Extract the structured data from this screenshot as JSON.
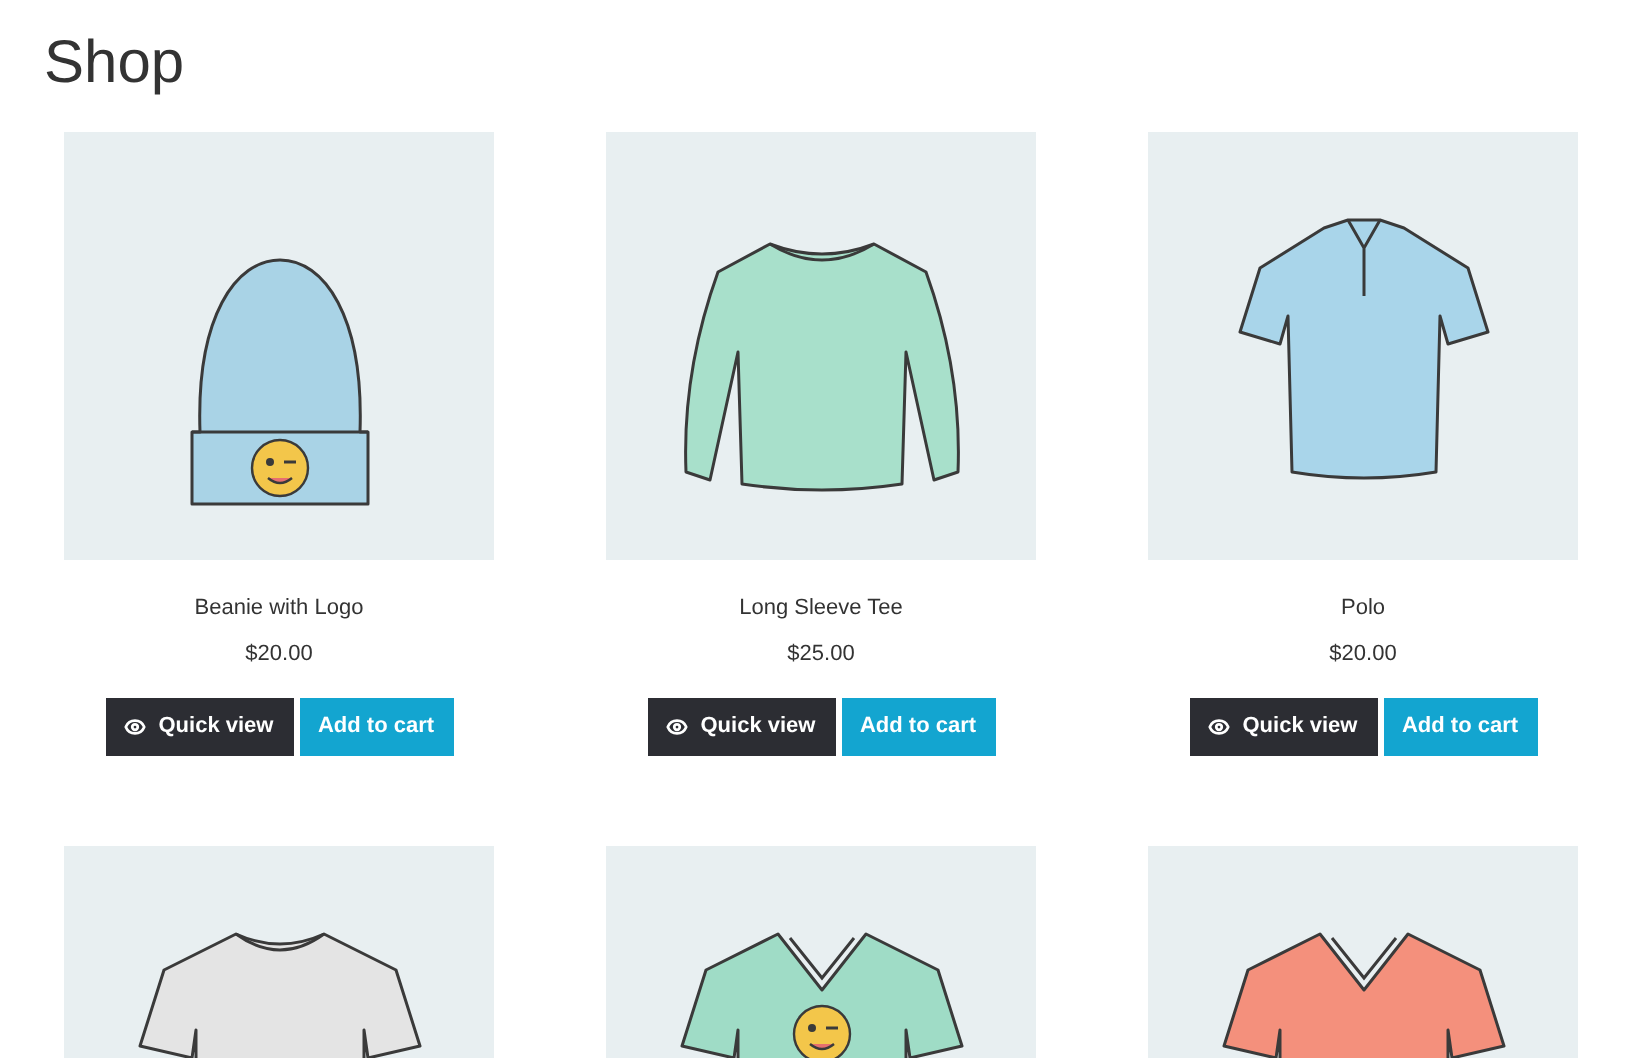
{
  "title": "Shop",
  "products": [
    {
      "kind": "beanie",
      "color": "#a9d3e6",
      "logo": true,
      "name": "Beanie with Logo",
      "price": "$20.00",
      "quick_view": "Quick view",
      "add_to_cart": "Add to cart"
    },
    {
      "kind": "longsleeve",
      "color": "#a8e0cb",
      "logo": false,
      "name": "Long Sleeve Tee",
      "price": "$25.00",
      "quick_view": "Quick view",
      "add_to_cart": "Add to cart"
    },
    {
      "kind": "polo",
      "color": "#a9d5ea",
      "logo": false,
      "name": "Polo",
      "price": "$20.00",
      "quick_view": "Quick view",
      "add_to_cart": "Add to cart"
    }
  ],
  "more_products": [
    {
      "kind": "tshirt",
      "color": "#e4e4e4",
      "logo": false
    },
    {
      "kind": "vneck",
      "color": "#9fdcc6",
      "logo": true
    },
    {
      "kind": "vneck",
      "color": "#f4907c",
      "logo": false
    }
  ]
}
